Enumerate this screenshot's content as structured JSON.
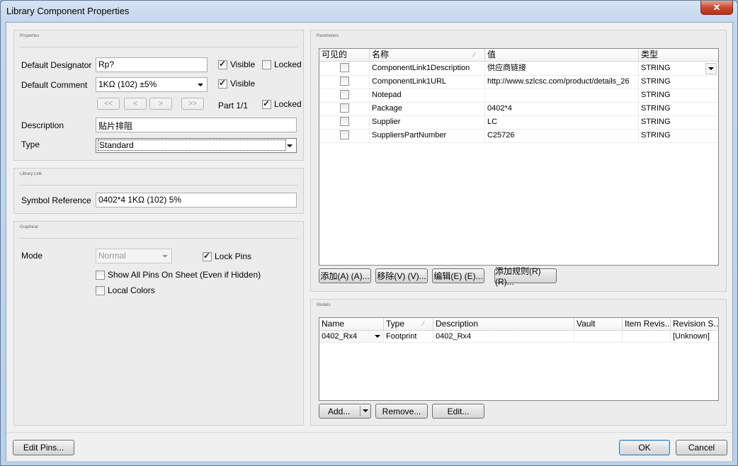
{
  "window": {
    "title": "Library Component Properties"
  },
  "properties": {
    "group_title": "Properties",
    "default_designator_label": "Default Designator",
    "default_designator_value": "Rp?",
    "designator_visible_label": "Visible",
    "designator_visible_checked": true,
    "designator_locked_label": "Locked",
    "designator_locked_checked": false,
    "default_comment_label": "Default Comment",
    "default_comment_value": "1KΩ (102) ±5%",
    "comment_visible_label": "Visible",
    "comment_visible_checked": true,
    "nav_first": "<<",
    "nav_prev": "<",
    "nav_next": ">",
    "nav_last": ">>",
    "part_label": "Part 1/1",
    "part_locked_label": "Locked",
    "part_locked_checked": true,
    "description_label": "Description",
    "description_value": "贴片排阻",
    "type_label": "Type",
    "type_value": "Standard"
  },
  "library_link": {
    "group_title": "Library Link",
    "symbol_reference_label": "Symbol Reference",
    "symbol_reference_value": "0402*4 1KΩ (102) 5%"
  },
  "graphical": {
    "group_title": "Graphical",
    "mode_label": "Mode",
    "mode_value": "Normal",
    "lock_pins_label": "Lock Pins",
    "lock_pins_checked": true,
    "show_all_pins_label": "Show All Pins On Sheet (Even if Hidden)",
    "show_all_pins_checked": false,
    "local_colors_label": "Local Colors",
    "local_colors_checked": false
  },
  "parameters": {
    "group_title": "Parameters",
    "columns": [
      "可见的",
      "名称",
      "值",
      "类型"
    ],
    "rows": [
      {
        "visible": false,
        "name": "ComponentLink1Description",
        "value": "供应商链接",
        "type": "STRING"
      },
      {
        "visible": false,
        "name": "ComponentLink1URL",
        "value": "http://www.szlcsc.com/product/details_26",
        "type": "STRING"
      },
      {
        "visible": false,
        "name": "Notepad",
        "value": "",
        "type": "STRING"
      },
      {
        "visible": false,
        "name": "Package",
        "value": "0402*4",
        "type": "STRING"
      },
      {
        "visible": false,
        "name": "Supplier",
        "value": "LC",
        "type": "STRING"
      },
      {
        "visible": false,
        "name": "SuppliersPartNumber",
        "value": "C25726",
        "type": "STRING"
      }
    ],
    "add_button": "添加(A) (A)...",
    "remove_button": "移除(V) (V)...",
    "edit_button": "编辑(E) (E)...",
    "add_rule_button": "添加规则(R) (R)..."
  },
  "models": {
    "group_title": "Models",
    "columns": [
      "Name",
      "Type",
      "Description",
      "Vault",
      "Item Revis...",
      "Revision S..."
    ],
    "rows": [
      {
        "name": "0402_Rx4",
        "type": "Footprint",
        "description": "0402_Rx4",
        "vault": "",
        "item_revision": "",
        "revision_state": "[Unknown]"
      }
    ],
    "add_button": "Add...",
    "remove_button": "Remove...",
    "edit_button": "Edit..."
  },
  "footer": {
    "edit_pins_button": "Edit Pins...",
    "ok_button": "OK",
    "cancel_button": "Cancel"
  }
}
